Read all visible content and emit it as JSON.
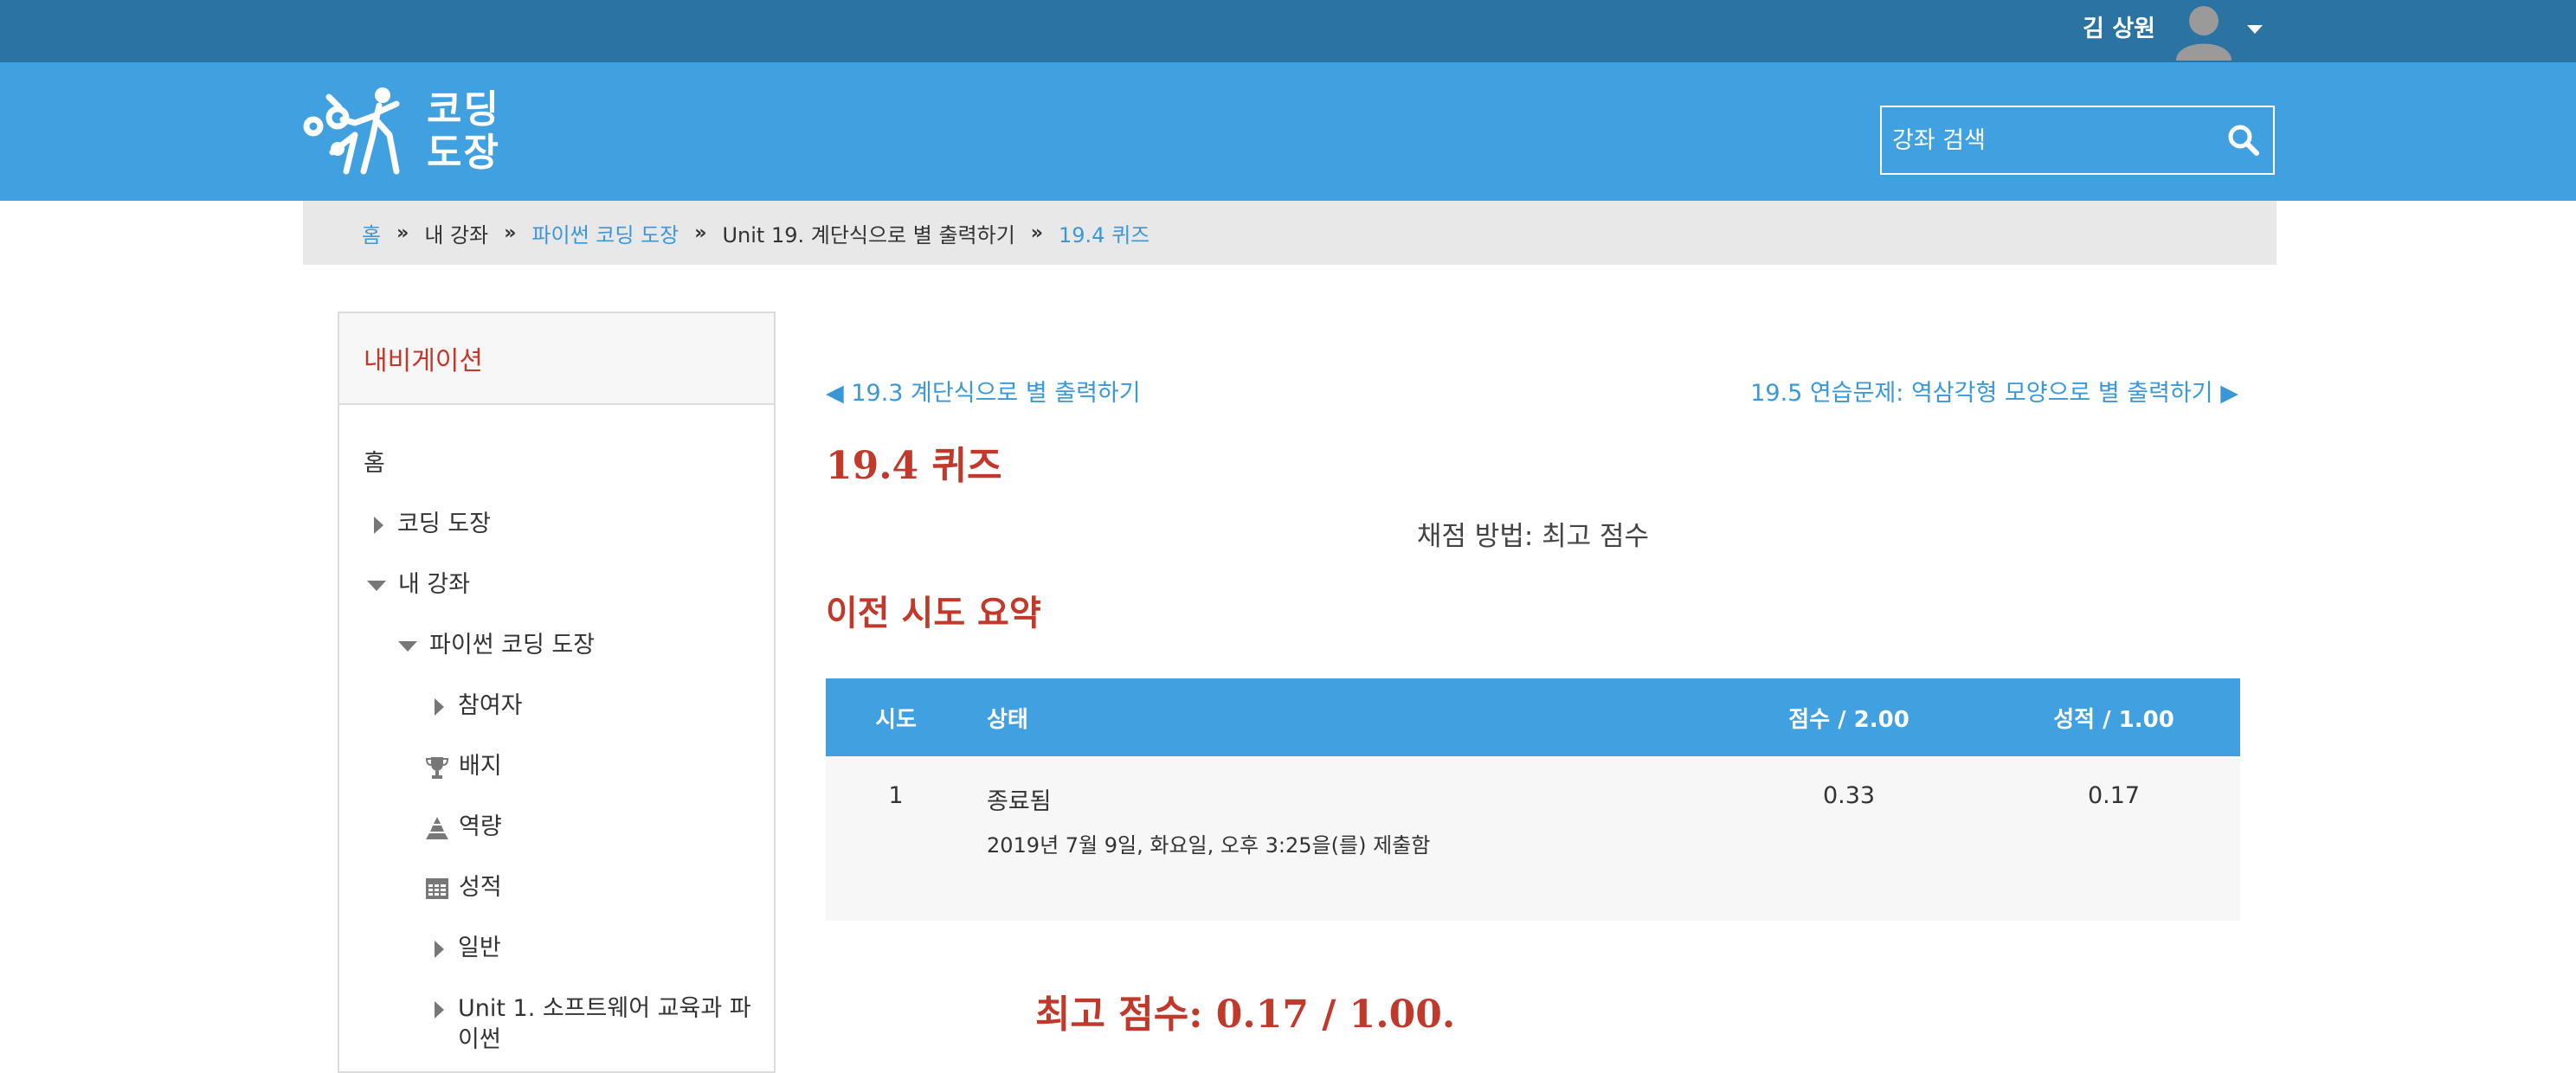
{
  "topbar": {
    "user_name": "김 상원",
    "avatar_icon": "user-avatar-icon",
    "menu_icon": "caret-down-icon"
  },
  "header": {
    "logo_text_line1": "코딩",
    "logo_text_line2": "도장",
    "search": {
      "placeholder": "강좌 검색",
      "icon": "search-icon"
    },
    "bg_color": "#41a0e0",
    "topbar_color": "#2a73a3"
  },
  "breadcrumb": {
    "items": [
      "홈",
      "내 강좌",
      "파이썬 코딩 도장",
      "Unit 19. 계단식으로 별 출력하기",
      "19.4 퀴즈"
    ],
    "separator": "»"
  },
  "navigation": {
    "title": "내비게이션",
    "items": [
      {
        "label": "홈",
        "icon": ""
      },
      {
        "label": "코딩 도장",
        "icon": "chevron-right-icon"
      },
      {
        "label": "내 강좌",
        "icon": "chevron-down-icon"
      },
      {
        "label": "파이썬 코딩 도장",
        "icon": "chevron-down-icon"
      },
      {
        "label": "참여자",
        "icon": "chevron-right-icon"
      },
      {
        "label": "배지",
        "icon": "trophy-icon"
      },
      {
        "label": "역량",
        "icon": "competency-icon"
      },
      {
        "label": "성적",
        "icon": "grades-table-icon"
      },
      {
        "label": "일반",
        "icon": "chevron-right-icon"
      },
      {
        "label": "Unit 1. 소프트웨어 교육과 파",
        "label_cont": "이썬",
        "icon": "chevron-right-icon"
      }
    ]
  },
  "main": {
    "prev_link": "◀ 19.3 계단식으로 별 출력하기",
    "next_link": "19.5 연습문제: 역삼각형 모양으로 별 출력하기 ▶",
    "title": "19.4 퀴즈",
    "grading_method": "채점 방법: 최고 점수",
    "summary_title": "이전 시도 요약",
    "table": {
      "headers": [
        "시도",
        "상태",
        "점수 / 2.00",
        "성적 / 1.00"
      ],
      "rows": [
        {
          "attempt": "1",
          "status": "종료됨",
          "submitted": "2019년 7월 9일, 화요일, 오후 3:25을(를) 제출함",
          "marks": "0.33",
          "grade": "0.17"
        }
      ]
    },
    "best_grade": "최고 점수: 0.17 / 1.00.",
    "accent_color": "#c0392b",
    "link_color": "#3a98d8"
  }
}
